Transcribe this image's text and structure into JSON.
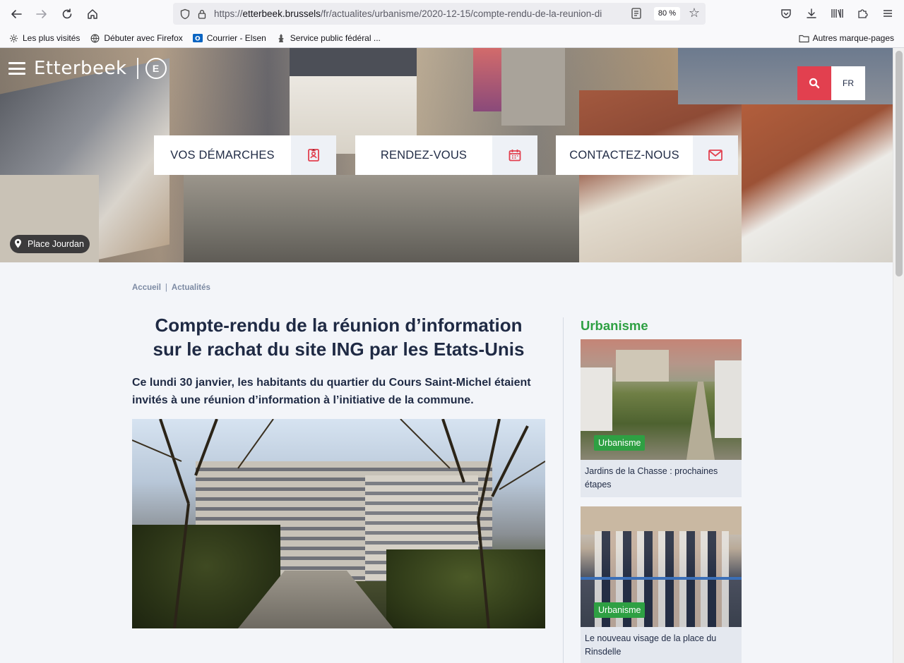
{
  "browser": {
    "url_prefix": "https://",
    "url_host": "etterbeek.brussels",
    "url_path": "/fr/actualites/urbanisme/2020-12-15/compte-rendu-de-la-reunion-di",
    "zoom": "80 %",
    "bookmarks": [
      {
        "label": "Les plus visités",
        "icon": "gear-icon"
      },
      {
        "label": "Débuter avec Firefox",
        "icon": "globe-icon"
      },
      {
        "label": "Courrier - Elsen",
        "icon": "outlook-icon"
      },
      {
        "label": "Service public fédéral ...",
        "icon": "federal-icon"
      }
    ],
    "other_bookmarks": "Autres marque-pages"
  },
  "header": {
    "logo": "Etterbeek",
    "lang": "FR",
    "quick_links": [
      {
        "label": "VOS DÉMARCHES",
        "icon": "id-card-icon"
      },
      {
        "label": "RENDEZ-VOUS",
        "icon": "calendar-icon"
      },
      {
        "label": "CONTACTEZ-NOUS",
        "icon": "mail-icon"
      }
    ],
    "place": "Place Jourdan"
  },
  "breadcrumb": [
    "Accueil",
    "Actualités"
  ],
  "article": {
    "title": "Compte-rendu de la réunion d’information sur le rachat du site ING par les Etats-Unis",
    "lead": "Ce lundi 30 janvier, les habitants du quartier du Cours Saint-Michel étaient invités à une réunion d’information à l’initiative de la commune."
  },
  "sidebar": {
    "title": "Urbanisme",
    "cards": [
      {
        "badge": "Urbanisme",
        "text": "Jardins de la Chasse : prochaines étapes"
      },
      {
        "badge": "Urbanisme",
        "text": "Le nouveau visage de la place du Rinsdelle"
      }
    ]
  },
  "colors": {
    "accent_red": "#e2404f",
    "accent_green": "#2ea043",
    "navy": "#1f2a44"
  }
}
